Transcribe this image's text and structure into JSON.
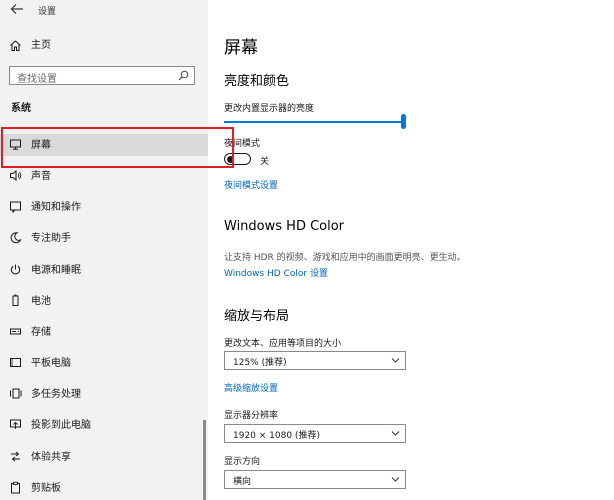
{
  "app": {
    "title": "设置"
  },
  "sidebar": {
    "home_label": "主页",
    "search_placeholder": "查找设置",
    "section_label": "系统",
    "items": [
      {
        "label": "屏幕",
        "icon": "monitor-icon",
        "selected": true
      },
      {
        "label": "声音",
        "icon": "speaker-icon"
      },
      {
        "label": "通知和操作",
        "icon": "notification-icon"
      },
      {
        "label": "专注助手",
        "icon": "moon-icon"
      },
      {
        "label": "电源和睡眠",
        "icon": "power-icon"
      },
      {
        "label": "电池",
        "icon": "battery-icon"
      },
      {
        "label": "存储",
        "icon": "storage-icon"
      },
      {
        "label": "平板电脑",
        "icon": "tablet-icon"
      },
      {
        "label": "多任务处理",
        "icon": "multitask-icon"
      },
      {
        "label": "投影到此电脑",
        "icon": "project-icon"
      },
      {
        "label": "体验共享",
        "icon": "share-icon"
      },
      {
        "label": "剪贴板",
        "icon": "clipboard-icon"
      }
    ]
  },
  "main": {
    "title": "屏幕",
    "brightness": {
      "heading": "亮度和颜色",
      "slider_label": "更改内置显示器的亮度",
      "level_percent": 100
    },
    "night_light": {
      "label": "夜间模式",
      "state": "关",
      "settings_link": "夜间模式设置"
    },
    "hd_color": {
      "heading": "Windows HD Color",
      "description": "让支持 HDR 的视频、游戏和应用中的画面更明亮、更生动。",
      "link": "Windows HD Color 设置"
    },
    "scale_layout": {
      "heading": "缩放与布局",
      "scale_label": "更改文本、应用等项目的大小",
      "scale_value": "125% (推荐)",
      "advanced_link": "高级缩放设置",
      "resolution_label": "显示器分辨率",
      "resolution_value": "1920 × 1080 (推荐)",
      "orientation_label": "显示方向",
      "orientation_value": "横向"
    }
  },
  "colors": {
    "accent": "#0078d7",
    "link": "#0067c0",
    "highlight_box": "#e02020",
    "sidebar_bg": "#f2f2f2",
    "selected_bg": "#d9d9d9"
  }
}
